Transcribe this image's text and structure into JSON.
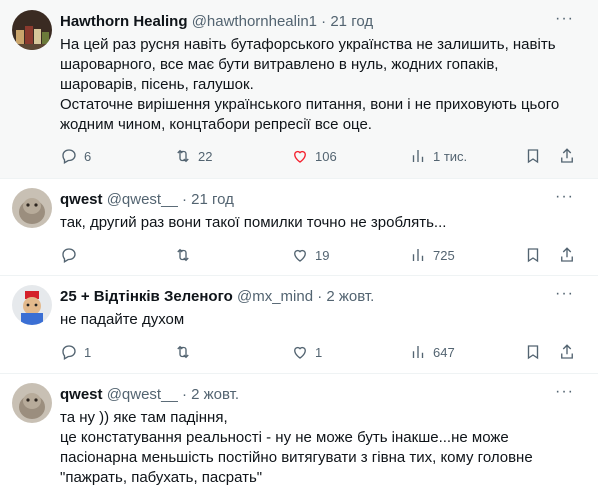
{
  "tweets": [
    {
      "name": "Hawthorn Healing",
      "handle": "@hawthornhealin1",
      "time": "21 год",
      "lines": [
        "На цей раз русня навіть бутафорського українства не залишить, навіть",
        "шароварного, все має бути витравлено в нуль, жодних гопаків,",
        "шароварів, пісень, галушок.",
        "Остаточне вирішення українського питання, вони і не приховують цього",
        "жодним чином, концтабори репресії все оце."
      ],
      "replies": "6",
      "retweets": "22",
      "likes": "106",
      "views": "1 тис."
    },
    {
      "name": "qwest",
      "handle": "@qwest__",
      "time": "21 год",
      "lines": [
        "так, другий раз вони такої помилки точно не зроблять..."
      ],
      "replies": "",
      "retweets": "",
      "likes": "19",
      "views": "725"
    },
    {
      "name": "25 + Відтінків Зеленого",
      "handle": "@mx_mind",
      "time": "2 жовт.",
      "lines": [
        "не падайте духом"
      ],
      "replies": "1",
      "retweets": "",
      "likes": "1",
      "views": "647"
    },
    {
      "name": "qwest",
      "handle": "@qwest__",
      "time": "2 жовт.",
      "lines": [
        "та ну )) яке там падіння,",
        "це констатування реальності - ну не може буть інакше...не може",
        "пасіонарна меньшість постійно витягувати з гівна тих, кому головне",
        "\"пажрать, пабухать, пасрать\""
      ]
    }
  ],
  "separator": "·",
  "more_label": "···"
}
